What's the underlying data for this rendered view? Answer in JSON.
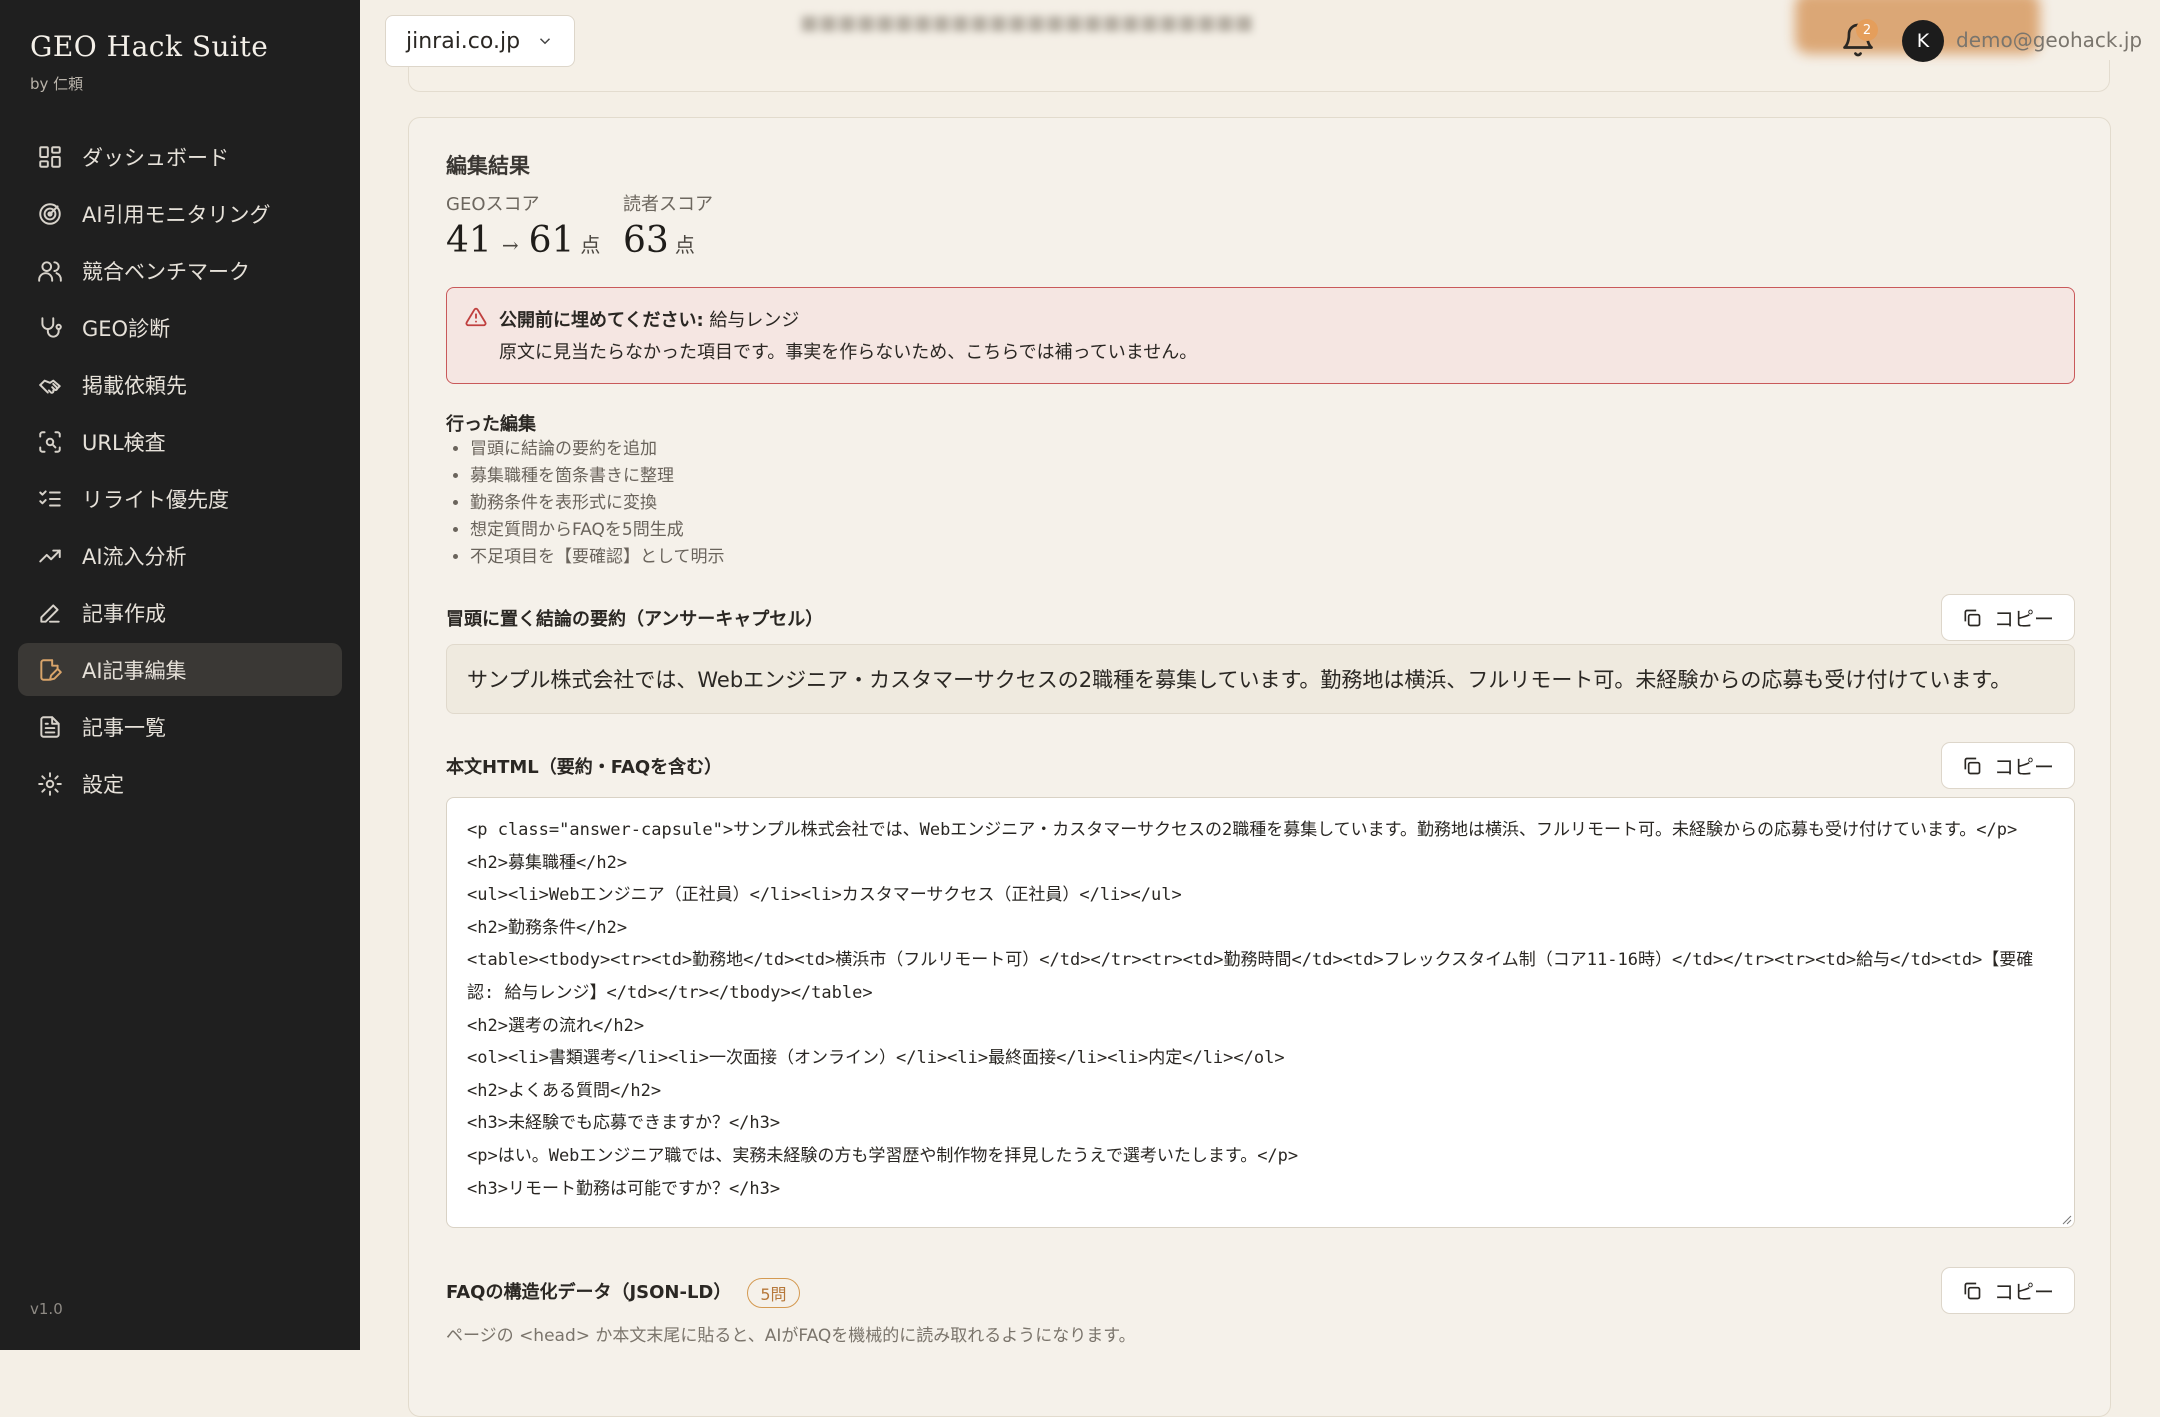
{
  "brand": {
    "title": "GEO Hack Suite",
    "subtitle": "by 仁頼"
  },
  "sidebar": {
    "items": [
      {
        "label": "ダッシュボード",
        "icon": "dashboard-icon"
      },
      {
        "label": "AI引用モニタリング",
        "icon": "target-icon"
      },
      {
        "label": "競合ベンチマーク",
        "icon": "users-icon"
      },
      {
        "label": "GEO診断",
        "icon": "stethoscope-icon"
      },
      {
        "label": "掲載依頼先",
        "icon": "handshake-icon"
      },
      {
        "label": "URL検査",
        "icon": "scan-search-icon"
      },
      {
        "label": "リライト優先度",
        "icon": "list-checks-icon"
      },
      {
        "label": "AI流入分析",
        "icon": "trending-up-icon"
      },
      {
        "label": "記事作成",
        "icon": "pen-icon"
      },
      {
        "label": "AI記事編集",
        "icon": "file-edit-icon",
        "active": true
      },
      {
        "label": "記事一覧",
        "icon": "file-text-icon"
      },
      {
        "label": "設定",
        "icon": "settings-icon"
      }
    ],
    "version": "v1.0"
  },
  "header": {
    "site": "jinrai.co.jp",
    "notifications": "2",
    "avatar_initial": "K",
    "email": "demo@geohack.jp"
  },
  "result": {
    "title": "編集結果",
    "geo_label": "GEOスコア",
    "geo_before": "41",
    "geo_arrow": "→",
    "geo_after": "61",
    "unit": "点",
    "reader_label": "読者スコア",
    "reader_score": "63",
    "alert_strong": "公開前に埋めてください:",
    "alert_item": " 給与レンジ",
    "alert_desc": "原文に見当たらなかった項目です。事実を作らないため、こちらでは補っていません。",
    "edits_title": "行った編集",
    "edits": [
      "冒頭に結論の要約を追加",
      "募集職種を箇条書きに整理",
      "勤務条件を表形式に変換",
      "想定質問からFAQを5問生成",
      "不足項目を【要確認】として明示"
    ],
    "capsule_title": "冒頭に置く結論の要約（アンサーキャプセル）",
    "capsule_text": "サンプル株式会社では、Webエンジニア・カスタマーサクセスの2職種を募集しています。勤務地は横浜、フルリモート可。未経験からの応募も受け付けています。",
    "html_title": "本文HTML（要約・FAQを含む）",
    "copy_label": "コピー",
    "html_lines": [
      "<p class=\"answer-capsule\">サンプル株式会社では、Webエンジニア・カスタマーサクセスの2職種を募集しています。勤務地は横浜、フルリモート可。未経験からの応募も受け付けています。</p>",
      "<h2>募集職種</h2>",
      "<ul><li>Webエンジニア（正社員）</li><li>カスタマーサクセス（正社員）</li></ul>",
      "<h2>勤務条件</h2>",
      "<table><tbody><tr><td>勤務地</td><td>横浜市（フルリモート可）</td></tr><tr><td>勤務時間</td><td>フレックスタイム制（コア11-16時）</td></tr><tr><td>給与</td><td>【要確認: 給与レンジ】</td></tr></tbody></table>",
      "<h2>選考の流れ</h2>",
      "<ol><li>書類選考</li><li>一次面接（オンライン）</li><li>最終面接</li><li>内定</li></ol>",
      "<h2>よくある質問</h2>",
      "<h3>未経験でも応募できますか？</h3>",
      "<p>はい。Webエンジニア職では、実務未経験の方も学習歴や制作物を拝見したうえで選考いたします。</p>",
      "<h3>リモート勤務は可能ですか？</h3>"
    ],
    "faq_title": "FAQの構造化データ（JSON-LD）",
    "faq_badge": "5問",
    "faq_desc": "ページの <head> か本文末尾に貼ると、AIがFAQを機械的に読み取れるようになります。"
  }
}
